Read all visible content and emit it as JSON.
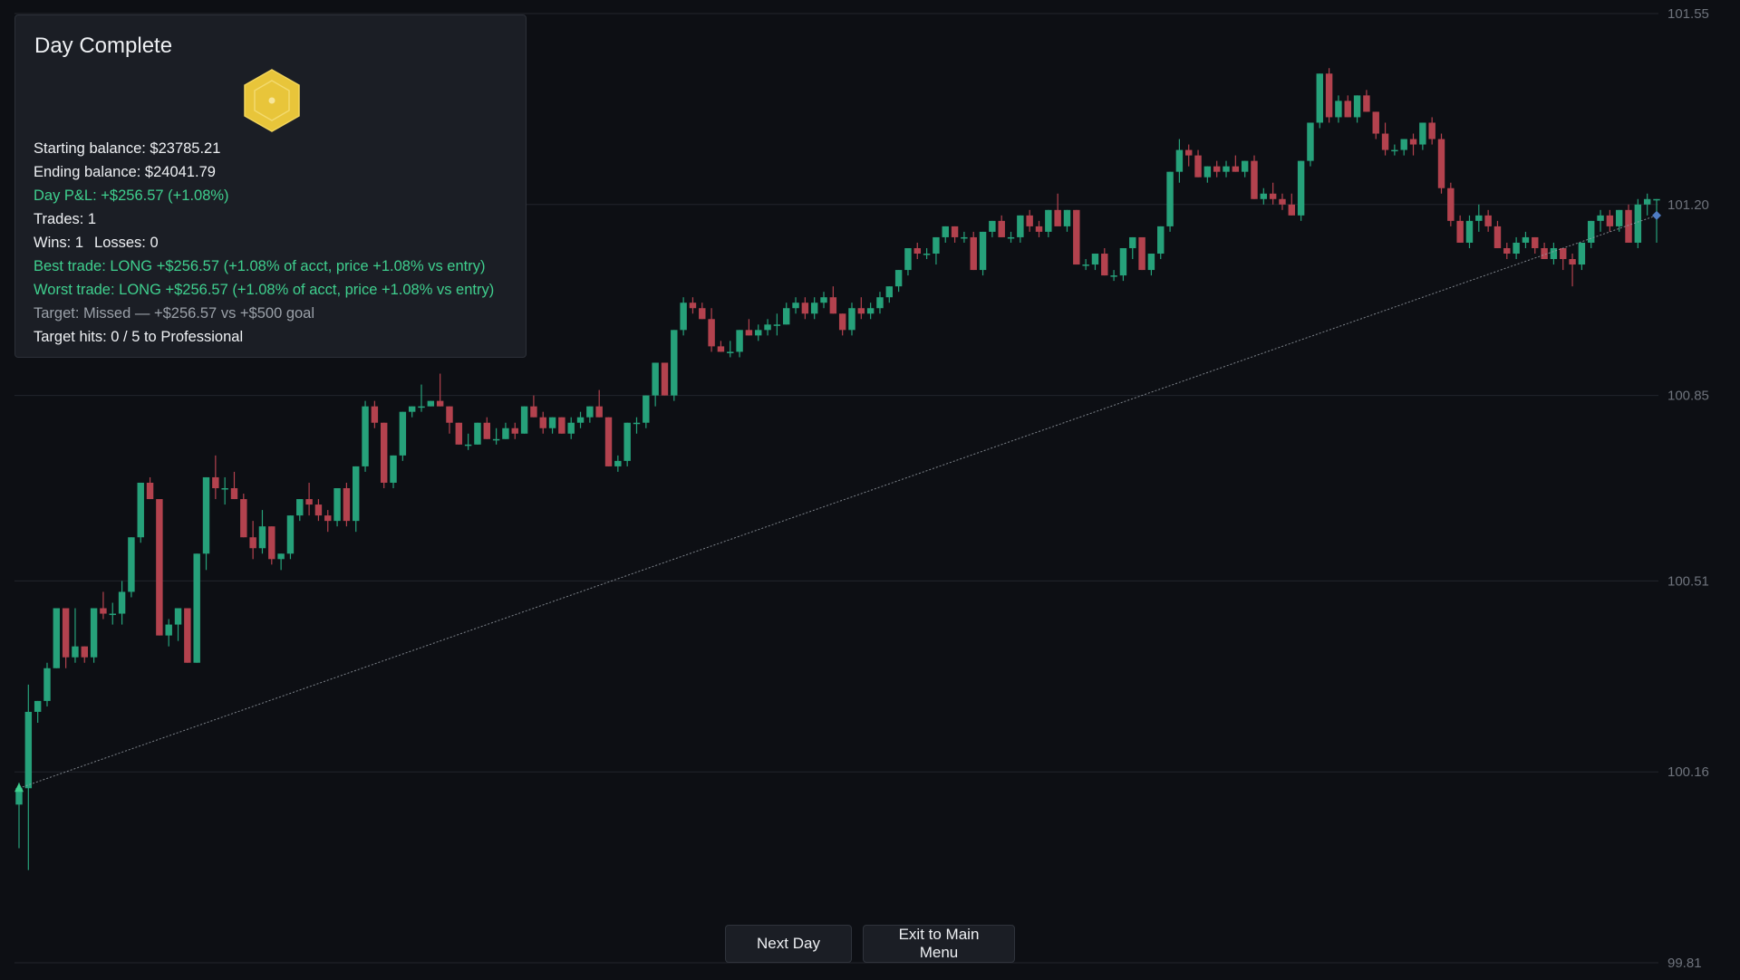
{
  "summary": {
    "title": "Day Complete",
    "badge_icon": "gold-hexagon-badge-icon",
    "starting_balance": "Starting balance: $23785.21",
    "ending_balance": "Ending balance: $24041.79",
    "day_pnl": "Day P&L: +$256.57 (+1.08%)",
    "trades": "Trades: 1",
    "wins": "Wins: 1",
    "losses": "Losses: 0",
    "best_trade": "Best trade: LONG +$256.57 (+1.08% of acct, price +1.08% vs entry)",
    "worst_trade": "Worst trade: LONG +$256.57 (+1.08% of acct, price +1.08% vs entry)",
    "target": "Target: Missed — +$256.57 vs +$500 goal",
    "target_hits": "Target hits: 0 / 5 to Professional"
  },
  "buttons": {
    "next_day": "Next Day",
    "exit_main_menu": "Exit to Main Menu"
  },
  "colors": {
    "background": "#0d0f14",
    "up_candle": "#26a17a",
    "down_candle": "#b3424e",
    "positive_text": "#3fcf8e",
    "badge_gold": "#e8c53a",
    "grid": "#22252c"
  },
  "chart_data": {
    "type": "candlestick",
    "y_ticks": [
      "101.55",
      "101.20",
      "100.85",
      "100.51",
      "100.16",
      "99.81"
    ],
    "y_tick_values": [
      101.55,
      101.2,
      100.85,
      100.51,
      100.16,
      99.81
    ],
    "ylim": [
      99.81,
      101.55
    ],
    "grid": true,
    "trade_line": {
      "entry_price": 100.13,
      "exit_price": 101.18,
      "side": "LONG"
    },
    "candles": [
      [
        100.1,
        100.14,
        100.02,
        100.13
      ],
      [
        100.13,
        100.32,
        99.98,
        100.27
      ],
      [
        100.27,
        100.29,
        100.25,
        100.29
      ],
      [
        100.29,
        100.36,
        100.28,
        100.35
      ],
      [
        100.35,
        100.46,
        100.35,
        100.46
      ],
      [
        100.46,
        100.46,
        100.35,
        100.37
      ],
      [
        100.37,
        100.46,
        100.36,
        100.39
      ],
      [
        100.39,
        100.39,
        100.36,
        100.37
      ],
      [
        100.37,
        100.46,
        100.36,
        100.46
      ],
      [
        100.46,
        100.49,
        100.44,
        100.45
      ],
      [
        100.45,
        100.47,
        100.43,
        100.45
      ],
      [
        100.45,
        100.51,
        100.43,
        100.49
      ],
      [
        100.49,
        100.59,
        100.48,
        100.59
      ],
      [
        100.59,
        100.69,
        100.58,
        100.69
      ],
      [
        100.69,
        100.7,
        100.66,
        100.66
      ],
      [
        100.66,
        100.65,
        100.41,
        100.41
      ],
      [
        100.41,
        100.44,
        100.39,
        100.43
      ],
      [
        100.43,
        100.46,
        100.4,
        100.46
      ],
      [
        100.46,
        100.46,
        100.36,
        100.36
      ],
      [
        100.36,
        100.56,
        100.36,
        100.56
      ],
      [
        100.56,
        100.7,
        100.53,
        100.7
      ],
      [
        100.7,
        100.74,
        100.66,
        100.68
      ],
      [
        100.68,
        100.7,
        100.65,
        100.68
      ],
      [
        100.68,
        100.71,
        100.66,
        100.66
      ],
      [
        100.66,
        100.67,
        100.59,
        100.59
      ],
      [
        100.59,
        100.62,
        100.55,
        100.57
      ],
      [
        100.57,
        100.64,
        100.56,
        100.61
      ],
      [
        100.61,
        100.61,
        100.54,
        100.55
      ],
      [
        100.55,
        100.56,
        100.53,
        100.56
      ],
      [
        100.56,
        100.63,
        100.55,
        100.63
      ],
      [
        100.63,
        100.66,
        100.62,
        100.66
      ],
      [
        100.66,
        100.69,
        100.63,
        100.65
      ],
      [
        100.65,
        100.66,
        100.62,
        100.63
      ],
      [
        100.63,
        100.64,
        100.6,
        100.62
      ],
      [
        100.62,
        100.68,
        100.61,
        100.68
      ],
      [
        100.68,
        100.69,
        100.61,
        100.62
      ],
      [
        100.62,
        100.72,
        100.6,
        100.72
      ],
      [
        100.72,
        100.84,
        100.71,
        100.83
      ],
      [
        100.83,
        100.84,
        100.79,
        100.8
      ],
      [
        100.8,
        100.8,
        100.68,
        100.69
      ],
      [
        100.69,
        100.74,
        100.68,
        100.74
      ],
      [
        100.74,
        100.82,
        100.73,
        100.82
      ],
      [
        100.82,
        100.83,
        100.81,
        100.83
      ],
      [
        100.83,
        100.87,
        100.82,
        100.83
      ],
      [
        100.83,
        100.84,
        100.83,
        100.84
      ],
      [
        100.84,
        100.89,
        100.83,
        100.83
      ],
      [
        100.83,
        100.83,
        100.78,
        100.8
      ],
      [
        100.8,
        100.8,
        100.76,
        100.76
      ],
      [
        100.76,
        100.78,
        100.75,
        100.76
      ],
      [
        100.76,
        100.8,
        100.76,
        100.8
      ],
      [
        100.8,
        100.81,
        100.77,
        100.77
      ],
      [
        100.77,
        100.79,
        100.76,
        100.77
      ],
      [
        100.77,
        100.8,
        100.77,
        100.79
      ],
      [
        100.79,
        100.8,
        100.77,
        100.78
      ],
      [
        100.78,
        100.83,
        100.78,
        100.83
      ],
      [
        100.83,
        100.85,
        100.81,
        100.81
      ],
      [
        100.81,
        100.82,
        100.78,
        100.79
      ],
      [
        100.79,
        100.81,
        100.78,
        100.81
      ],
      [
        100.81,
        100.81,
        100.78,
        100.78
      ],
      [
        100.78,
        100.81,
        100.77,
        100.8
      ],
      [
        100.8,
        100.82,
        100.79,
        100.81
      ],
      [
        100.81,
        100.83,
        100.8,
        100.83
      ],
      [
        100.83,
        100.86,
        100.81,
        100.81
      ],
      [
        100.81,
        100.81,
        100.72,
        100.72
      ],
      [
        100.72,
        100.74,
        100.71,
        100.73
      ],
      [
        100.73,
        100.8,
        100.72,
        100.8
      ],
      [
        100.8,
        100.81,
        100.78,
        100.8
      ],
      [
        100.8,
        100.85,
        100.79,
        100.85
      ],
      [
        100.85,
        100.91,
        100.83,
        100.91
      ],
      [
        100.91,
        100.91,
        100.85,
        100.85
      ],
      [
        100.85,
        100.97,
        100.84,
        100.97
      ],
      [
        100.97,
        101.03,
        100.96,
        101.02
      ],
      [
        101.02,
        101.03,
        101.0,
        101.01
      ],
      [
        101.01,
        101.02,
        100.99,
        100.99
      ],
      [
        100.99,
        101.01,
        100.93,
        100.94
      ],
      [
        100.94,
        100.95,
        100.93,
        100.93
      ],
      [
        100.93,
        100.95,
        100.92,
        100.93
      ],
      [
        100.93,
        100.97,
        100.92,
        100.97
      ],
      [
        100.97,
        100.99,
        100.96,
        100.96
      ],
      [
        100.96,
        100.98,
        100.95,
        100.97
      ],
      [
        100.97,
        100.99,
        100.96,
        100.98
      ],
      [
        100.98,
        101.0,
        100.96,
        100.98
      ],
      [
        100.98,
        101.02,
        100.98,
        101.01
      ],
      [
        101.01,
        101.03,
        101.0,
        101.02
      ],
      [
        101.02,
        101.03,
        100.99,
        101.0
      ],
      [
        101.0,
        101.03,
        100.99,
        101.02
      ],
      [
        101.02,
        101.04,
        101.01,
        101.03
      ],
      [
        101.03,
        101.05,
        101.0,
        101.0
      ],
      [
        101.0,
        101.0,
        100.96,
        100.97
      ],
      [
        100.97,
        101.02,
        100.96,
        101.01
      ],
      [
        101.01,
        101.03,
        100.99,
        101.0
      ],
      [
        101.0,
        101.02,
        100.99,
        101.01
      ],
      [
        101.01,
        101.04,
        101.0,
        101.03
      ],
      [
        101.03,
        101.05,
        101.02,
        101.05
      ],
      [
        101.05,
        101.08,
        101.04,
        101.08
      ],
      [
        101.08,
        101.12,
        101.07,
        101.12
      ],
      [
        101.12,
        101.13,
        101.1,
        101.11
      ],
      [
        101.11,
        101.12,
        101.1,
        101.11
      ],
      [
        101.11,
        101.14,
        101.09,
        101.14
      ],
      [
        101.14,
        101.16,
        101.13,
        101.16
      ],
      [
        101.16,
        101.16,
        101.13,
        101.14
      ],
      [
        101.14,
        101.15,
        101.13,
        101.14
      ],
      [
        101.14,
        101.15,
        101.08,
        101.08
      ],
      [
        101.08,
        101.15,
        101.07,
        101.15
      ],
      [
        101.15,
        101.17,
        101.14,
        101.17
      ],
      [
        101.17,
        101.18,
        101.14,
        101.14
      ],
      [
        101.14,
        101.15,
        101.13,
        101.14
      ],
      [
        101.14,
        101.18,
        101.13,
        101.18
      ],
      [
        101.18,
        101.19,
        101.15,
        101.16
      ],
      [
        101.16,
        101.17,
        101.14,
        101.15
      ],
      [
        101.15,
        101.19,
        101.14,
        101.19
      ],
      [
        101.19,
        101.22,
        101.18,
        101.16
      ],
      [
        101.16,
        101.19,
        101.15,
        101.19
      ],
      [
        101.19,
        101.19,
        101.09,
        101.09
      ],
      [
        101.09,
        101.1,
        101.08,
        101.09
      ],
      [
        101.09,
        101.11,
        101.08,
        101.11
      ],
      [
        101.11,
        101.12,
        101.07,
        101.07
      ],
      [
        101.07,
        101.08,
        101.06,
        101.07
      ],
      [
        101.07,
        101.12,
        101.06,
        101.12
      ],
      [
        101.12,
        101.14,
        101.1,
        101.14
      ],
      [
        101.14,
        101.13,
        101.08,
        101.08
      ],
      [
        101.08,
        101.11,
        101.07,
        101.11
      ],
      [
        101.11,
        101.16,
        101.1,
        101.16
      ],
      [
        101.16,
        101.26,
        101.15,
        101.26
      ],
      [
        101.26,
        101.32,
        101.24,
        101.3
      ],
      [
        101.3,
        101.31,
        101.27,
        101.29
      ],
      [
        101.29,
        101.3,
        101.25,
        101.25
      ],
      [
        101.25,
        101.27,
        101.24,
        101.27
      ],
      [
        101.27,
        101.28,
        101.25,
        101.26
      ],
      [
        101.26,
        101.28,
        101.25,
        101.27
      ],
      [
        101.27,
        101.29,
        101.26,
        101.26
      ],
      [
        101.26,
        101.28,
        101.25,
        101.28
      ],
      [
        101.28,
        101.29,
        101.21,
        101.21
      ],
      [
        101.21,
        101.23,
        101.2,
        101.22
      ],
      [
        101.22,
        101.24,
        101.2,
        101.21
      ],
      [
        101.21,
        101.22,
        101.19,
        101.2
      ],
      [
        101.2,
        101.22,
        101.18,
        101.18
      ],
      [
        101.18,
        101.28,
        101.17,
        101.28
      ],
      [
        101.28,
        101.35,
        101.27,
        101.35
      ],
      [
        101.35,
        101.44,
        101.34,
        101.44
      ],
      [
        101.44,
        101.45,
        101.35,
        101.36
      ],
      [
        101.36,
        101.4,
        101.35,
        101.39
      ],
      [
        101.39,
        101.4,
        101.36,
        101.36
      ],
      [
        101.36,
        101.4,
        101.35,
        101.4
      ],
      [
        101.4,
        101.41,
        101.37,
        101.37
      ],
      [
        101.37,
        101.37,
        101.32,
        101.33
      ],
      [
        101.33,
        101.35,
        101.29,
        101.3
      ],
      [
        101.3,
        101.31,
        101.29,
        101.3
      ],
      [
        101.3,
        101.32,
        101.29,
        101.32
      ],
      [
        101.32,
        101.33,
        101.29,
        101.31
      ],
      [
        101.31,
        101.35,
        101.3,
        101.35
      ],
      [
        101.35,
        101.36,
        101.31,
        101.32
      ],
      [
        101.32,
        101.33,
        101.22,
        101.23
      ],
      [
        101.23,
        101.24,
        101.16,
        101.17
      ],
      [
        101.17,
        101.18,
        101.13,
        101.13
      ],
      [
        101.13,
        101.18,
        101.12,
        101.17
      ],
      [
        101.17,
        101.2,
        101.15,
        101.18
      ],
      [
        101.18,
        101.19,
        101.15,
        101.16
      ],
      [
        101.16,
        101.17,
        101.12,
        101.12
      ],
      [
        101.12,
        101.13,
        101.1,
        101.11
      ],
      [
        101.11,
        101.14,
        101.1,
        101.13
      ],
      [
        101.13,
        101.15,
        101.12,
        101.14
      ],
      [
        101.14,
        101.14,
        101.11,
        101.12
      ],
      [
        101.12,
        101.13,
        101.1,
        101.1
      ],
      [
        101.1,
        101.13,
        101.09,
        101.12
      ],
      [
        101.12,
        101.12,
        101.08,
        101.1
      ],
      [
        101.1,
        101.11,
        101.05,
        101.09
      ],
      [
        101.09,
        101.13,
        101.08,
        101.13
      ],
      [
        101.13,
        101.17,
        101.12,
        101.17
      ],
      [
        101.17,
        101.19,
        101.15,
        101.18
      ],
      [
        101.18,
        101.19,
        101.15,
        101.16
      ],
      [
        101.16,
        101.19,
        101.15,
        101.19
      ],
      [
        101.19,
        101.2,
        101.13,
        101.13
      ],
      [
        101.13,
        101.21,
        101.12,
        101.2
      ],
      [
        101.2,
        101.22,
        101.18,
        101.21
      ],
      [
        101.21,
        101.21,
        101.13,
        101.21
      ]
    ]
  }
}
